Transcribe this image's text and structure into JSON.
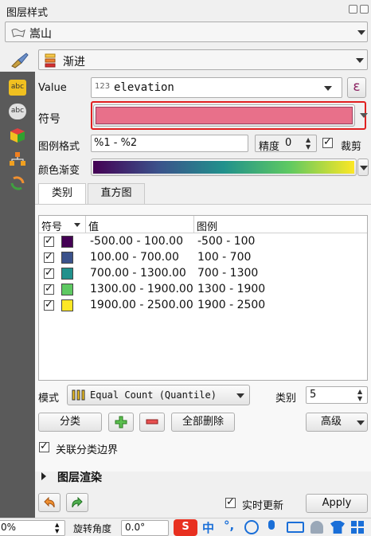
{
  "panel": {
    "title": "图层样式"
  },
  "layer": {
    "name": "嵩山"
  },
  "renderer": {
    "name": "渐进"
  },
  "value": {
    "label": "Value",
    "type_prefix": "123",
    "field": "elevation",
    "expr_icon": "ε"
  },
  "symbol": {
    "label": "符号",
    "color": "#e8708a"
  },
  "legend_format": {
    "label": "图例格式",
    "value": "%1 - %2",
    "precision_label": "精度",
    "precision": "0",
    "trim_label": "裁剪"
  },
  "color_ramp": {
    "label": "颜色渐变"
  },
  "tabs": [
    "类别",
    "直方图"
  ],
  "table": {
    "headers": [
      "符号",
      "值",
      "图例"
    ],
    "rows": [
      {
        "color": "#440154",
        "value": "-500.00 - 100.00",
        "legend": "-500 - 100"
      },
      {
        "color": "#3b528b",
        "value": "100.00 - 700.00",
        "legend": "100 - 700"
      },
      {
        "color": "#21918c",
        "value": "700.00 - 1300.00",
        "legend": "700 - 1300"
      },
      {
        "color": "#5ec962",
        "value": "1300.00 - 1900.00",
        "legend": "1300 - 1900"
      },
      {
        "color": "#fde725",
        "value": "1900.00 - 2500.00",
        "legend": "1900 - 2500"
      }
    ]
  },
  "mode": {
    "label": "模式",
    "value": "Equal Count (Quantile)",
    "classes_label": "类别",
    "classes": "5"
  },
  "buttons": {
    "classify": "分类",
    "delete_all": "全部删除",
    "advanced": "高级"
  },
  "link_boundaries": "关联分类边界",
  "layer_rendering": "图层渲染",
  "live_update": "实时更新",
  "apply": "Apply",
  "statusbar": {
    "zoom": "0%",
    "rotation_label": "旋转角度",
    "rotation": "0.0°",
    "ime_text": "中"
  }
}
